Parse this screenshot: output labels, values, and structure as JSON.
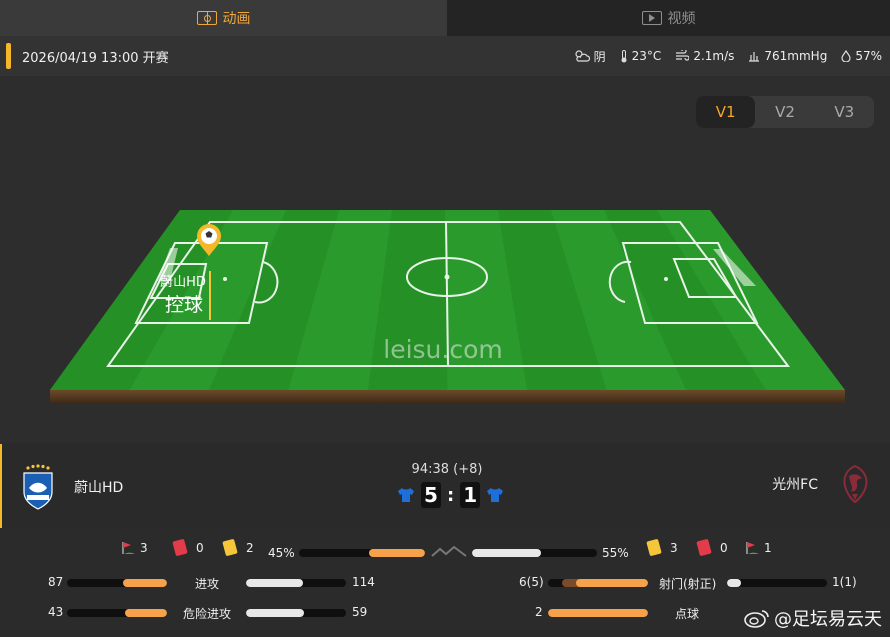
{
  "tabs": [
    {
      "label": "动画",
      "icon": "pitch-icon",
      "active": true
    },
    {
      "label": "视频",
      "icon": "tv-icon",
      "active": false
    }
  ],
  "info": {
    "datetime": "2026/04/19 13:00 开赛",
    "weather": {
      "condition": "阴",
      "temp": "23°C",
      "wind": "2.1m/s",
      "pressure": "761mmHg",
      "humidity": "57%"
    }
  },
  "view_buttons": [
    "V1",
    "V2",
    "V3"
  ],
  "pitch": {
    "watermark": "leisu.com",
    "ball_team": "蔚山HD",
    "ball_status": "控球"
  },
  "match": {
    "clock": "94:38 (+8)",
    "home": {
      "name": "蔚山HD",
      "score": "5"
    },
    "away": {
      "name": "光州FC",
      "score": "1"
    },
    "colon": ":"
  },
  "stats": {
    "home_corners": "3",
    "home_red": "0",
    "home_yellow": "2",
    "home_possession": "45%",
    "away_possession": "55%",
    "away_yellow": "3",
    "away_red": "0",
    "away_corners": "1",
    "possession_fraction_home": 0.45,
    "attacks": {
      "label": "进攻",
      "home": "87",
      "away": "114"
    },
    "dangerous": {
      "label": "危险进攻",
      "home": "43",
      "away": "59"
    },
    "shots": {
      "label": "射门(射正)",
      "home": "6(5)",
      "away": "1(1)"
    },
    "penalties": {
      "label": "点球",
      "home": "2",
      "away": ""
    }
  },
  "watermark_social": "@足坛易云天",
  "colors": {
    "accent": "#f5a623",
    "grass": "#2a9a2a",
    "home_bar": "#f5a24a",
    "away_bar": "#e8e8e8"
  }
}
